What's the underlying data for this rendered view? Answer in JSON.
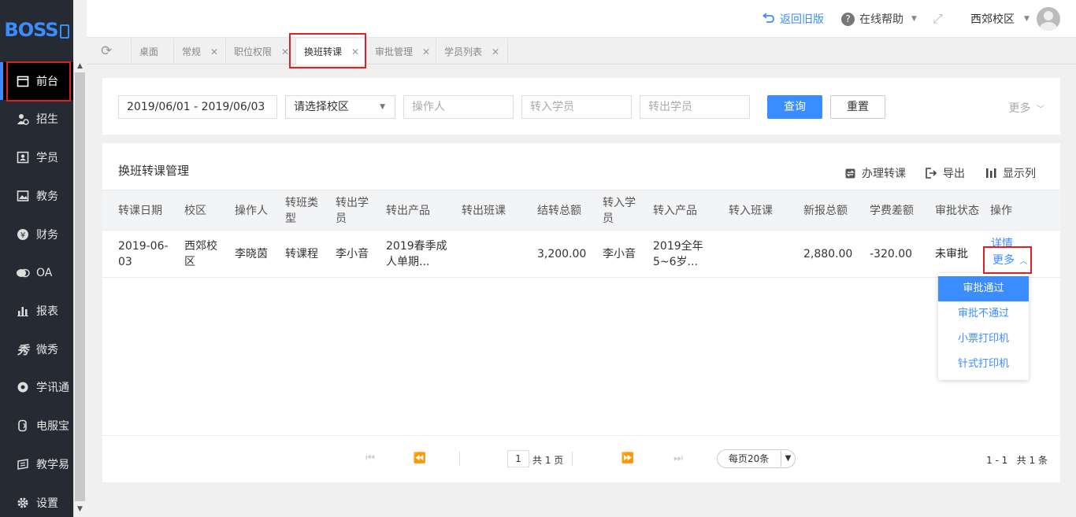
{
  "brand": {
    "logo_text": "BOSS"
  },
  "sidebar": {
    "items": [
      {
        "label": "前台",
        "icon": "calendar-icon"
      },
      {
        "label": "招生",
        "icon": "user-plus-icon"
      },
      {
        "label": "学员",
        "icon": "id-card-icon"
      },
      {
        "label": "教务",
        "icon": "image-icon"
      },
      {
        "label": "财务",
        "icon": "yen-icon"
      },
      {
        "label": "OA",
        "icon": "chat-icon"
      },
      {
        "label": "报表",
        "icon": "bar-chart-icon"
      },
      {
        "label": "微秀",
        "icon": "xiu-icon"
      },
      {
        "label": "学讯通",
        "icon": "location-icon"
      },
      {
        "label": "电服宝",
        "icon": "phone-icon"
      },
      {
        "label": "教学易",
        "icon": "book-icon"
      },
      {
        "label": "设置",
        "icon": "gear-icon"
      }
    ]
  },
  "topbar": {
    "back_old": "返回旧版",
    "help": "在线帮助",
    "campus": "西郊校区"
  },
  "tabs": [
    {
      "label": "桌面",
      "closable": false
    },
    {
      "label": "常规",
      "closable": true
    },
    {
      "label": "职位权限",
      "closable": true
    },
    {
      "label": "换班转课",
      "closable": true,
      "active": true
    },
    {
      "label": "审批管理",
      "closable": true
    },
    {
      "label": "学员列表",
      "closable": true
    }
  ],
  "filter": {
    "date_range": "2019/06/01 - 2019/06/03",
    "campus_placeholder": "请选择校区",
    "operator_placeholder": "操作人",
    "in_student_placeholder": "转入学员",
    "out_student_placeholder": "转出学员",
    "search_label": "查询",
    "reset_label": "重置",
    "more_label": "更多"
  },
  "panel": {
    "title": "换班转课管理",
    "actions": {
      "transfer": "办理转课",
      "export": "导出",
      "columns": "显示列"
    }
  },
  "table": {
    "headers": [
      "转课日期",
      "校区",
      "操作人",
      "转班类型",
      "转出学员",
      "转出产品",
      "转出班课",
      "结转总额",
      "转入学员",
      "转入产品",
      "转入班课",
      "新报总额",
      "学费差额",
      "审批状态",
      "操作"
    ],
    "rows": [
      {
        "date": "2019-06-03",
        "campus": "西郊校区",
        "operator": "李晓茵",
        "type": "转课程",
        "out_student": "李小音",
        "out_product": "2019春季成人单期...",
        "out_class": "",
        "carry_total": "3,200.00",
        "in_student": "李小音",
        "in_product": "2019全年5~6岁...",
        "in_class": "",
        "new_total": "2,880.00",
        "diff": "-320.00",
        "status": "未审批",
        "op_detail": "详情",
        "op_more": "更多"
      }
    ]
  },
  "dropdown": [
    "审批通过",
    "审批不通过",
    "小票打印机",
    "针式打印机"
  ],
  "pagination": {
    "page": "1",
    "total_pages_text": "共 1 页",
    "page_size": "每页20条",
    "summary": "1 - 1   共 1 条"
  },
  "colors": {
    "accent": "#3b8cff",
    "sidebar_bg": "#262b33",
    "highlight_box": "#e02020"
  }
}
